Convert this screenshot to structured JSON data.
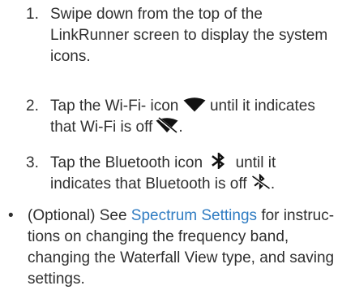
{
  "steps": [
    {
      "number": "1.",
      "lines": [
        "Swipe down from the top of the",
        "LinkRunner screen to display the system",
        "icons."
      ]
    },
    {
      "number": "2.",
      "line1_before_icon": "Tap the Wi-Fi- icon",
      "line1_after_icon": "until it indicates",
      "line2_before_icon": "that Wi-Fi is off",
      "line2_after_icon": "."
    },
    {
      "number": "3.",
      "line1_before_icon": "Tap the Bluetooth icon",
      "line1_after_icon": "until it",
      "line2_before_icon": "indicates that Bluetooth is off",
      "line2_after_icon": "."
    }
  ],
  "note": {
    "bullet": "•",
    "prefix": "(Optional) See ",
    "link_text": "Spectrum Settings",
    "suffix_line1": " for instruc-",
    "lines": [
      "tions on changing the frequency band,",
      "changing the Waterfall View type, and saving",
      "settings."
    ]
  },
  "icons": {
    "wifi_on": "wifi-icon",
    "wifi_off": "wifi-off-icon",
    "bluetooth_on": "bluetooth-icon",
    "bluetooth_off": "bluetooth-off-icon"
  },
  "colors": {
    "text": "#2f2f2f",
    "link": "#2f7cc2",
    "icon": "#111111"
  }
}
